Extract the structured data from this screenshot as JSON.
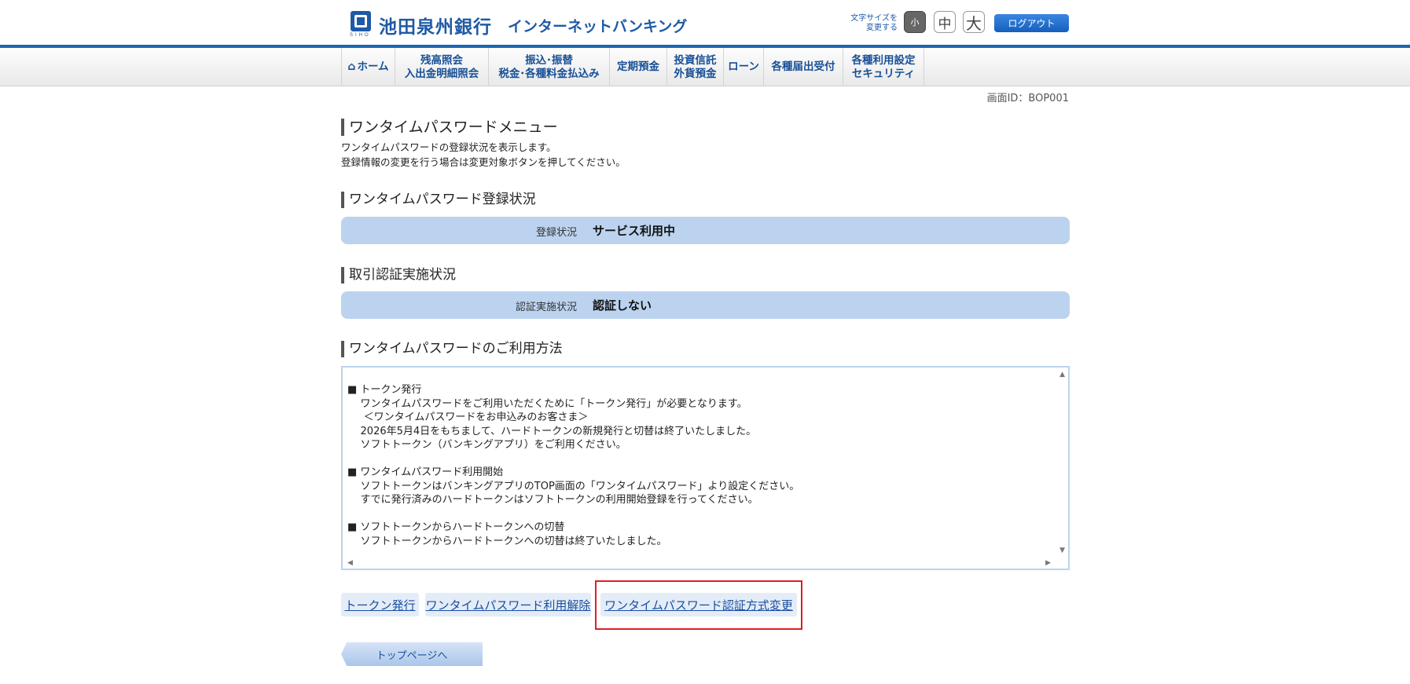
{
  "header": {
    "logo_sub": "SIHO",
    "bank_name": "池田泉州銀行",
    "service_name": "インターネットバンキング",
    "fontsize_label_1": "文字サイズを",
    "fontsize_label_2": "変更する",
    "fontsize_small": "小",
    "fontsize_medium": "中",
    "fontsize_large": "大",
    "logout": "ログアウト"
  },
  "nav": {
    "home": "ホーム",
    "balance_1": "残高照会",
    "balance_2": "入出金明細照会",
    "transfer_1": "振込･振替",
    "transfer_2": "税金･各種料金払込み",
    "deposit": "定期預金",
    "invest_1": "投資信託",
    "invest_2": "外貨預金",
    "loan": "ローン",
    "forms": "各種届出受付",
    "settings_1": "各種利用設定",
    "settings_2": "セキュリティ"
  },
  "screen_id": "画面ID：BOP001",
  "page_title": "ワンタイムパスワードメニュー",
  "desc_1": "ワンタイムパスワードの登録状況を表示します。",
  "desc_2": "登録情報の変更を行う場合は変更対象ボタンを押してください。",
  "registration": {
    "heading": "ワンタイムパスワード登録状況",
    "label": "登録状況",
    "value": "サービス利用中"
  },
  "auth": {
    "heading": "取引認証実施状況",
    "label": "認証実施状況",
    "value": "認証しない"
  },
  "usage": {
    "heading": "ワンタイムパスワードのご利用方法",
    "text": "■ トークン発行\n    ワンタイムパスワードをご利用いただくために「トークン発行」が必要となります。\n     ＜ワンタイムパスワードをお申込みのお客さま＞\n    2026年5月4日をもちまして、ハードトークンの新規発行と切替は終了いたしました。\n    ソフトトークン（バンキングアプリ）をご利用ください。\n\n■ ワンタイムパスワード利用開始\n    ソフトトークンはバンキングアプリのTOP画面の「ワンタイムパスワード」より設定ください。\n    すでに発行済みのハードトークンはソフトトークンの利用開始登録を行ってください。\n\n■ ソフトトークンからハードトークンへの切替\n    ソフトトークンからハードトークンへの切替は終了いたしました。"
  },
  "buttons": {
    "token_issue": "トークン発行",
    "cancel_otp": "ワンタイムパスワード利用解除",
    "change_auth": "ワンタイムパスワード認証方式変更",
    "top_page": "トップページへ"
  }
}
